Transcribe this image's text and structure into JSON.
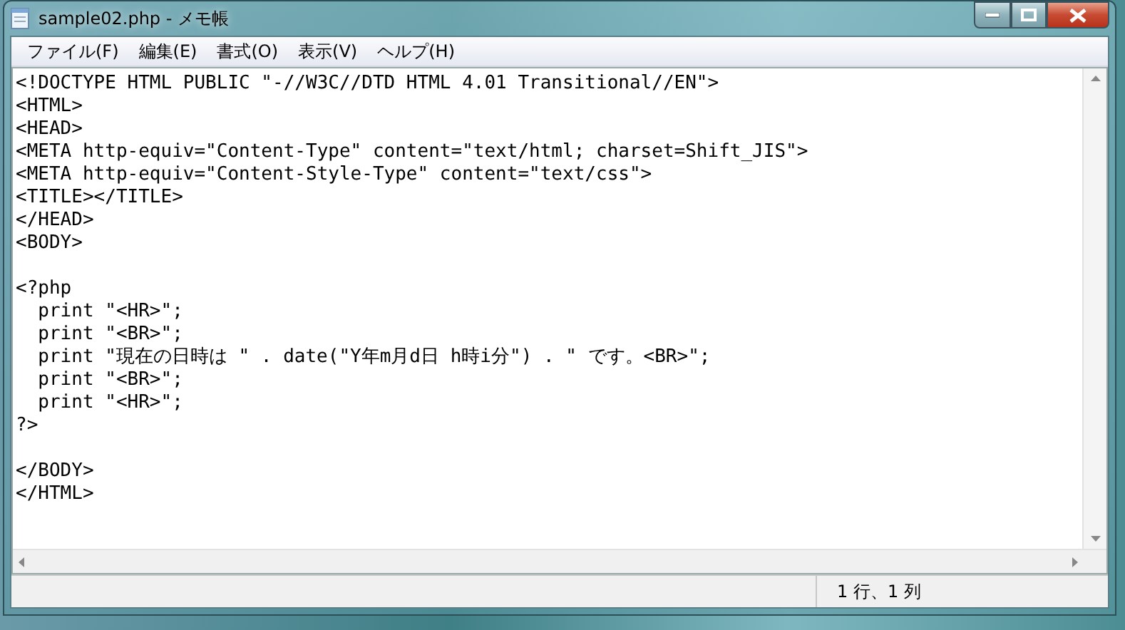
{
  "window": {
    "title": "sample02.php - メモ帳"
  },
  "menu": [
    {
      "label": "ファイル(F)"
    },
    {
      "label": "編集(E)"
    },
    {
      "label": "書式(O)"
    },
    {
      "label": "表示(V)"
    },
    {
      "label": "ヘルプ(H)"
    }
  ],
  "editor": {
    "blocks": [
      [
        "<!DOCTYPE HTML PUBLIC \"-//W3C//DTD HTML 4.01 Transitional//EN\">",
        "<HTML>",
        "<HEAD>",
        "<META http-equiv=\"Content-Type\" content=\"text/html; charset=Shift_JIS\">",
        "<META http-equiv=\"Content-Style-Type\" content=\"text/css\">",
        "<TITLE></TITLE>",
        "</HEAD>",
        "<BODY>"
      ],
      [
        "<?php",
        "  print \"<HR>\";",
        "  print \"<BR>\";",
        "  print \"現在の日時は \" . date(\"Y年m月d日 h時i分\") . \" です。<BR>\";",
        "  print \"<BR>\";",
        "  print \"<HR>\";",
        "?>"
      ],
      [
        "</BODY>",
        "</HTML>"
      ]
    ]
  },
  "status_bar": {
    "position": "1 行、1 列"
  }
}
